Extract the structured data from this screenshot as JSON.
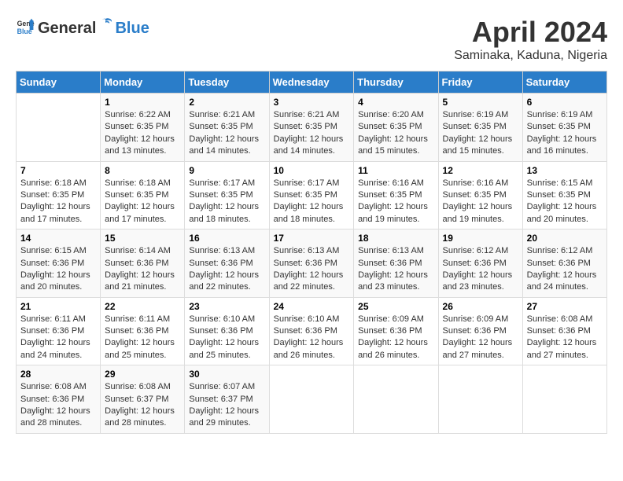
{
  "header": {
    "logo_general": "General",
    "logo_blue": "Blue",
    "title": "April 2024",
    "subtitle": "Saminaka, Kaduna, Nigeria"
  },
  "calendar": {
    "days_header": [
      "Sunday",
      "Monday",
      "Tuesday",
      "Wednesday",
      "Thursday",
      "Friday",
      "Saturday"
    ],
    "weeks": [
      [
        {
          "day": "",
          "info": ""
        },
        {
          "day": "1",
          "info": "Sunrise: 6:22 AM\nSunset: 6:35 PM\nDaylight: 12 hours\nand 13 minutes."
        },
        {
          "day": "2",
          "info": "Sunrise: 6:21 AM\nSunset: 6:35 PM\nDaylight: 12 hours\nand 14 minutes."
        },
        {
          "day": "3",
          "info": "Sunrise: 6:21 AM\nSunset: 6:35 PM\nDaylight: 12 hours\nand 14 minutes."
        },
        {
          "day": "4",
          "info": "Sunrise: 6:20 AM\nSunset: 6:35 PM\nDaylight: 12 hours\nand 15 minutes."
        },
        {
          "day": "5",
          "info": "Sunrise: 6:19 AM\nSunset: 6:35 PM\nDaylight: 12 hours\nand 15 minutes."
        },
        {
          "day": "6",
          "info": "Sunrise: 6:19 AM\nSunset: 6:35 PM\nDaylight: 12 hours\nand 16 minutes."
        }
      ],
      [
        {
          "day": "7",
          "info": "Sunrise: 6:18 AM\nSunset: 6:35 PM\nDaylight: 12 hours\nand 17 minutes."
        },
        {
          "day": "8",
          "info": "Sunrise: 6:18 AM\nSunset: 6:35 PM\nDaylight: 12 hours\nand 17 minutes."
        },
        {
          "day": "9",
          "info": "Sunrise: 6:17 AM\nSunset: 6:35 PM\nDaylight: 12 hours\nand 18 minutes."
        },
        {
          "day": "10",
          "info": "Sunrise: 6:17 AM\nSunset: 6:35 PM\nDaylight: 12 hours\nand 18 minutes."
        },
        {
          "day": "11",
          "info": "Sunrise: 6:16 AM\nSunset: 6:35 PM\nDaylight: 12 hours\nand 19 minutes."
        },
        {
          "day": "12",
          "info": "Sunrise: 6:16 AM\nSunset: 6:35 PM\nDaylight: 12 hours\nand 19 minutes."
        },
        {
          "day": "13",
          "info": "Sunrise: 6:15 AM\nSunset: 6:35 PM\nDaylight: 12 hours\nand 20 minutes."
        }
      ],
      [
        {
          "day": "14",
          "info": "Sunrise: 6:15 AM\nSunset: 6:36 PM\nDaylight: 12 hours\nand 20 minutes."
        },
        {
          "day": "15",
          "info": "Sunrise: 6:14 AM\nSunset: 6:36 PM\nDaylight: 12 hours\nand 21 minutes."
        },
        {
          "day": "16",
          "info": "Sunrise: 6:13 AM\nSunset: 6:36 PM\nDaylight: 12 hours\nand 22 minutes."
        },
        {
          "day": "17",
          "info": "Sunrise: 6:13 AM\nSunset: 6:36 PM\nDaylight: 12 hours\nand 22 minutes."
        },
        {
          "day": "18",
          "info": "Sunrise: 6:13 AM\nSunset: 6:36 PM\nDaylight: 12 hours\nand 23 minutes."
        },
        {
          "day": "19",
          "info": "Sunrise: 6:12 AM\nSunset: 6:36 PM\nDaylight: 12 hours\nand 23 minutes."
        },
        {
          "day": "20",
          "info": "Sunrise: 6:12 AM\nSunset: 6:36 PM\nDaylight: 12 hours\nand 24 minutes."
        }
      ],
      [
        {
          "day": "21",
          "info": "Sunrise: 6:11 AM\nSunset: 6:36 PM\nDaylight: 12 hours\nand 24 minutes."
        },
        {
          "day": "22",
          "info": "Sunrise: 6:11 AM\nSunset: 6:36 PM\nDaylight: 12 hours\nand 25 minutes."
        },
        {
          "day": "23",
          "info": "Sunrise: 6:10 AM\nSunset: 6:36 PM\nDaylight: 12 hours\nand 25 minutes."
        },
        {
          "day": "24",
          "info": "Sunrise: 6:10 AM\nSunset: 6:36 PM\nDaylight: 12 hours\nand 26 minutes."
        },
        {
          "day": "25",
          "info": "Sunrise: 6:09 AM\nSunset: 6:36 PM\nDaylight: 12 hours\nand 26 minutes."
        },
        {
          "day": "26",
          "info": "Sunrise: 6:09 AM\nSunset: 6:36 PM\nDaylight: 12 hours\nand 27 minutes."
        },
        {
          "day": "27",
          "info": "Sunrise: 6:08 AM\nSunset: 6:36 PM\nDaylight: 12 hours\nand 27 minutes."
        }
      ],
      [
        {
          "day": "28",
          "info": "Sunrise: 6:08 AM\nSunset: 6:36 PM\nDaylight: 12 hours\nand 28 minutes."
        },
        {
          "day": "29",
          "info": "Sunrise: 6:08 AM\nSunset: 6:37 PM\nDaylight: 12 hours\nand 28 minutes."
        },
        {
          "day": "30",
          "info": "Sunrise: 6:07 AM\nSunset: 6:37 PM\nDaylight: 12 hours\nand 29 minutes."
        },
        {
          "day": "",
          "info": ""
        },
        {
          "day": "",
          "info": ""
        },
        {
          "day": "",
          "info": ""
        },
        {
          "day": "",
          "info": ""
        }
      ]
    ]
  }
}
